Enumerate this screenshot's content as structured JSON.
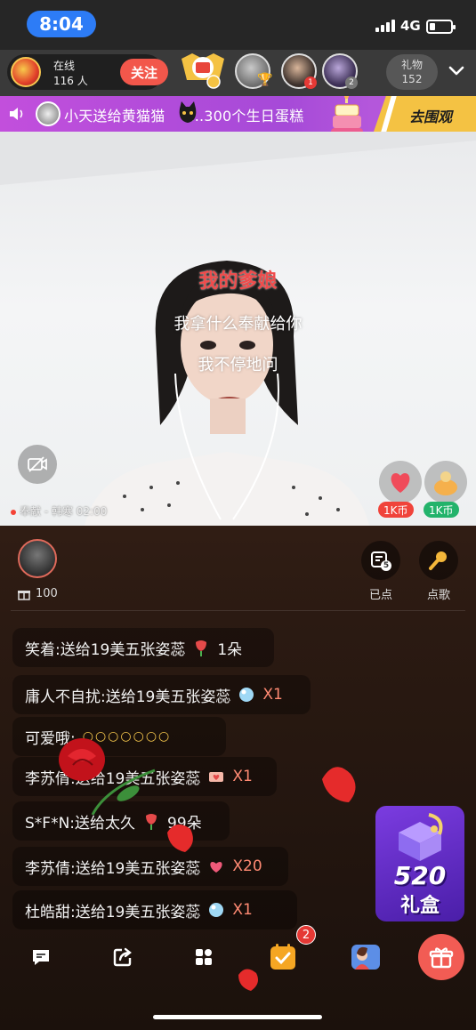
{
  "status_bar": {
    "time": "8:04",
    "network": "4G",
    "battery_level": 0.25
  },
  "header": {
    "online_label": "在线",
    "online_count": "116 人",
    "follow_label": "关注",
    "gift_label": "礼物",
    "gift_count": "152"
  },
  "banner": {
    "text": "小天送给黄猫猫",
    "text_suffix": "...300个生日蛋糕",
    "action_label": "去围观"
  },
  "video": {
    "lyrics": [
      "我的爹娘",
      "我拿什么奉献给你",
      "我不停地问"
    ],
    "now_playing": "奉献 - 韩寒 02:00",
    "quick_gifts": [
      {
        "icon": "heart-balloon-icon",
        "price": "1K币"
      },
      {
        "icon": "lucky-bag-icon",
        "price": "1K币"
      }
    ]
  },
  "panel": {
    "gift_value": "100",
    "ordered_label": "已点",
    "ordered_count": "5",
    "request_song_label": "点歌"
  },
  "chat": [
    {
      "prefix": "笑着:送给19美五张姿蕊",
      "gift_icon": "rose-icon",
      "qty": "1朵"
    },
    {
      "prefix": "庸人不自扰:送给19美五张姿蕊",
      "gift_icon": "crystal-ball-icon",
      "qty": "X1"
    },
    {
      "prefix": "可爱哦:",
      "gift_icon": "clap-icon",
      "qty": ""
    },
    {
      "prefix": "李苏倩:送给19美五张姿蕊",
      "gift_icon": "love-letter-icon",
      "qty": "X1"
    },
    {
      "prefix": "S*F*N:送给太久",
      "gift_icon": "rose-icon",
      "qty": "99朵"
    },
    {
      "prefix": "李苏倩:送给19美五张姿蕊",
      "gift_icon": "heart-box-icon",
      "qty": "X20"
    },
    {
      "prefix": "杜皓甜:送给19美五张姿蕊",
      "gift_icon": "crystal-ball-icon",
      "qty": "X1"
    }
  ],
  "promo": {
    "title": "520",
    "subtitle": "礼盒"
  },
  "bottom_bar": {
    "task_badge": "2"
  },
  "colors": {
    "accent_red": "#f2574b",
    "banner_purple": "#b14fdc",
    "banner_yellow": "#f4c243",
    "price_red": "#f0433a",
    "price_green": "#23b36b",
    "qty_orange": "#ff8a73"
  }
}
